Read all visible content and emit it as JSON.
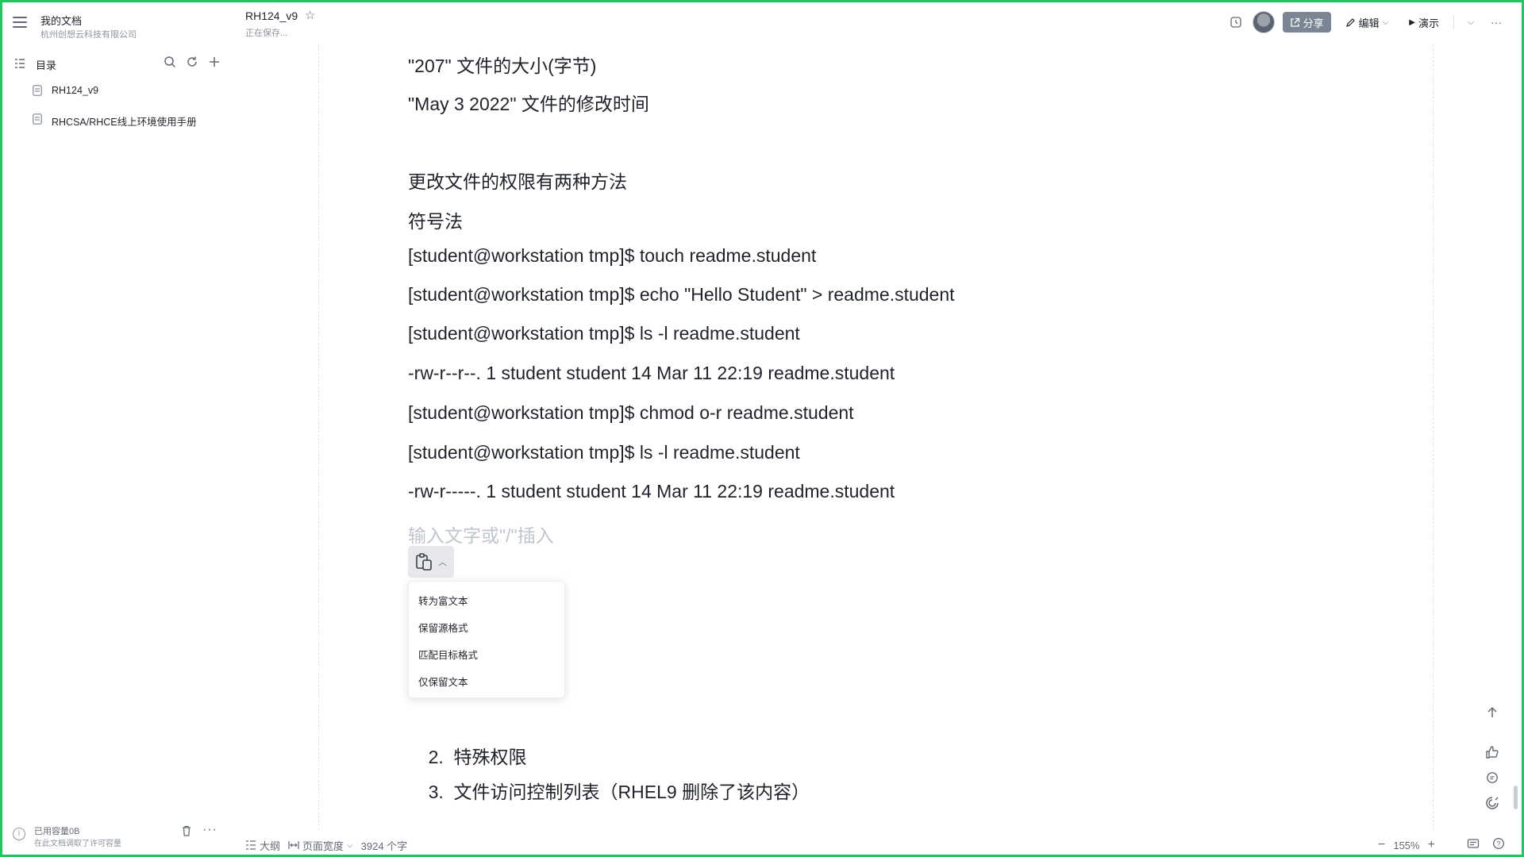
{
  "sidebar": {
    "workspace_name": "我的文档",
    "org_name": "杭州创想云科技有限公司",
    "toc_label": "目录",
    "items": [
      {
        "label": "RH124_v9"
      },
      {
        "label": "RHCSA/RHCE线上环境使用手册"
      }
    ],
    "storage_used": "已用容量0B",
    "storage_note": "在此文档调取了许可容量"
  },
  "header": {
    "doc_title": "RH124_v9",
    "save_status": "正在保存...",
    "share_label": "分享",
    "edit_label": "编辑",
    "present_label": "演示"
  },
  "content": {
    "lines": [
      "\"207\" 文件的大小(字节)",
      "\"May 3 2022\" 文件的修改时间",
      "更改文件的权限有两种方法",
      "符号法",
      "[student@workstation tmp]$ touch readme.student",
      "[student@workstation tmp]$ echo \"Hello Student\" > readme.student",
      "[student@workstation tmp]$ ls -l readme.student",
      "-rw-r--r--. 1 student student 14 Mar 11 22:19 readme.student",
      "[student@workstation tmp]$ chmod o-r readme.student",
      "[student@workstation tmp]$ ls -l readme.student",
      "-rw-r-----. 1 student student 14 Mar 11 22:19 readme.student"
    ],
    "placeholder": "输入文字或\"/\"插入",
    "numbered_items": [
      {
        "num": "2.",
        "text": "特殊权限"
      },
      {
        "num": "3.",
        "text": "文件访问控制列表（RHEL9 删除了该内容）"
      }
    ]
  },
  "paste_menu": {
    "options": [
      "转为富文本",
      "保留源格式",
      "匹配目标格式",
      "仅保留文本"
    ]
  },
  "bottom_bar": {
    "outline_label": "大纲",
    "page_width_label": "页面宽度",
    "word_count": "3924 个字",
    "zoom": "155%"
  }
}
